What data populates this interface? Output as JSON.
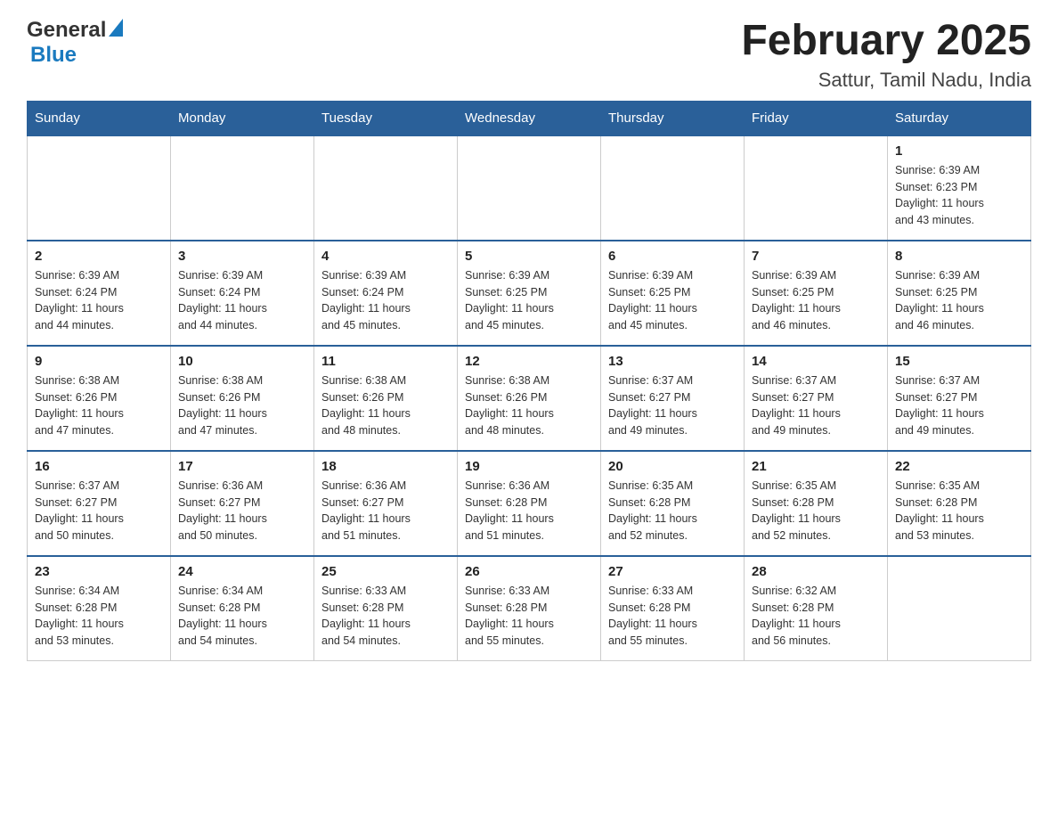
{
  "header": {
    "logo_general": "General",
    "logo_blue": "Blue",
    "month_title": "February 2025",
    "location": "Sattur, Tamil Nadu, India"
  },
  "days_of_week": [
    "Sunday",
    "Monday",
    "Tuesday",
    "Wednesday",
    "Thursday",
    "Friday",
    "Saturday"
  ],
  "weeks": [
    {
      "days": [
        {
          "number": "",
          "info": "",
          "empty": true
        },
        {
          "number": "",
          "info": "",
          "empty": true
        },
        {
          "number": "",
          "info": "",
          "empty": true
        },
        {
          "number": "",
          "info": "",
          "empty": true
        },
        {
          "number": "",
          "info": "",
          "empty": true
        },
        {
          "number": "",
          "info": "",
          "empty": true
        },
        {
          "number": "1",
          "info": "Sunrise: 6:39 AM\nSunset: 6:23 PM\nDaylight: 11 hours\nand 43 minutes.",
          "empty": false
        }
      ]
    },
    {
      "days": [
        {
          "number": "2",
          "info": "Sunrise: 6:39 AM\nSunset: 6:24 PM\nDaylight: 11 hours\nand 44 minutes.",
          "empty": false
        },
        {
          "number": "3",
          "info": "Sunrise: 6:39 AM\nSunset: 6:24 PM\nDaylight: 11 hours\nand 44 minutes.",
          "empty": false
        },
        {
          "number": "4",
          "info": "Sunrise: 6:39 AM\nSunset: 6:24 PM\nDaylight: 11 hours\nand 45 minutes.",
          "empty": false
        },
        {
          "number": "5",
          "info": "Sunrise: 6:39 AM\nSunset: 6:25 PM\nDaylight: 11 hours\nand 45 minutes.",
          "empty": false
        },
        {
          "number": "6",
          "info": "Sunrise: 6:39 AM\nSunset: 6:25 PM\nDaylight: 11 hours\nand 45 minutes.",
          "empty": false
        },
        {
          "number": "7",
          "info": "Sunrise: 6:39 AM\nSunset: 6:25 PM\nDaylight: 11 hours\nand 46 minutes.",
          "empty": false
        },
        {
          "number": "8",
          "info": "Sunrise: 6:39 AM\nSunset: 6:25 PM\nDaylight: 11 hours\nand 46 minutes.",
          "empty": false
        }
      ]
    },
    {
      "days": [
        {
          "number": "9",
          "info": "Sunrise: 6:38 AM\nSunset: 6:26 PM\nDaylight: 11 hours\nand 47 minutes.",
          "empty": false
        },
        {
          "number": "10",
          "info": "Sunrise: 6:38 AM\nSunset: 6:26 PM\nDaylight: 11 hours\nand 47 minutes.",
          "empty": false
        },
        {
          "number": "11",
          "info": "Sunrise: 6:38 AM\nSunset: 6:26 PM\nDaylight: 11 hours\nand 48 minutes.",
          "empty": false
        },
        {
          "number": "12",
          "info": "Sunrise: 6:38 AM\nSunset: 6:26 PM\nDaylight: 11 hours\nand 48 minutes.",
          "empty": false
        },
        {
          "number": "13",
          "info": "Sunrise: 6:37 AM\nSunset: 6:27 PM\nDaylight: 11 hours\nand 49 minutes.",
          "empty": false
        },
        {
          "number": "14",
          "info": "Sunrise: 6:37 AM\nSunset: 6:27 PM\nDaylight: 11 hours\nand 49 minutes.",
          "empty": false
        },
        {
          "number": "15",
          "info": "Sunrise: 6:37 AM\nSunset: 6:27 PM\nDaylight: 11 hours\nand 49 minutes.",
          "empty": false
        }
      ]
    },
    {
      "days": [
        {
          "number": "16",
          "info": "Sunrise: 6:37 AM\nSunset: 6:27 PM\nDaylight: 11 hours\nand 50 minutes.",
          "empty": false
        },
        {
          "number": "17",
          "info": "Sunrise: 6:36 AM\nSunset: 6:27 PM\nDaylight: 11 hours\nand 50 minutes.",
          "empty": false
        },
        {
          "number": "18",
          "info": "Sunrise: 6:36 AM\nSunset: 6:27 PM\nDaylight: 11 hours\nand 51 minutes.",
          "empty": false
        },
        {
          "number": "19",
          "info": "Sunrise: 6:36 AM\nSunset: 6:28 PM\nDaylight: 11 hours\nand 51 minutes.",
          "empty": false
        },
        {
          "number": "20",
          "info": "Sunrise: 6:35 AM\nSunset: 6:28 PM\nDaylight: 11 hours\nand 52 minutes.",
          "empty": false
        },
        {
          "number": "21",
          "info": "Sunrise: 6:35 AM\nSunset: 6:28 PM\nDaylight: 11 hours\nand 52 minutes.",
          "empty": false
        },
        {
          "number": "22",
          "info": "Sunrise: 6:35 AM\nSunset: 6:28 PM\nDaylight: 11 hours\nand 53 minutes.",
          "empty": false
        }
      ]
    },
    {
      "days": [
        {
          "number": "23",
          "info": "Sunrise: 6:34 AM\nSunset: 6:28 PM\nDaylight: 11 hours\nand 53 minutes.",
          "empty": false
        },
        {
          "number": "24",
          "info": "Sunrise: 6:34 AM\nSunset: 6:28 PM\nDaylight: 11 hours\nand 54 minutes.",
          "empty": false
        },
        {
          "number": "25",
          "info": "Sunrise: 6:33 AM\nSunset: 6:28 PM\nDaylight: 11 hours\nand 54 minutes.",
          "empty": false
        },
        {
          "number": "26",
          "info": "Sunrise: 6:33 AM\nSunset: 6:28 PM\nDaylight: 11 hours\nand 55 minutes.",
          "empty": false
        },
        {
          "number": "27",
          "info": "Sunrise: 6:33 AM\nSunset: 6:28 PM\nDaylight: 11 hours\nand 55 minutes.",
          "empty": false
        },
        {
          "number": "28",
          "info": "Sunrise: 6:32 AM\nSunset: 6:28 PM\nDaylight: 11 hours\nand 56 minutes.",
          "empty": false
        },
        {
          "number": "",
          "info": "",
          "empty": true
        }
      ]
    }
  ]
}
